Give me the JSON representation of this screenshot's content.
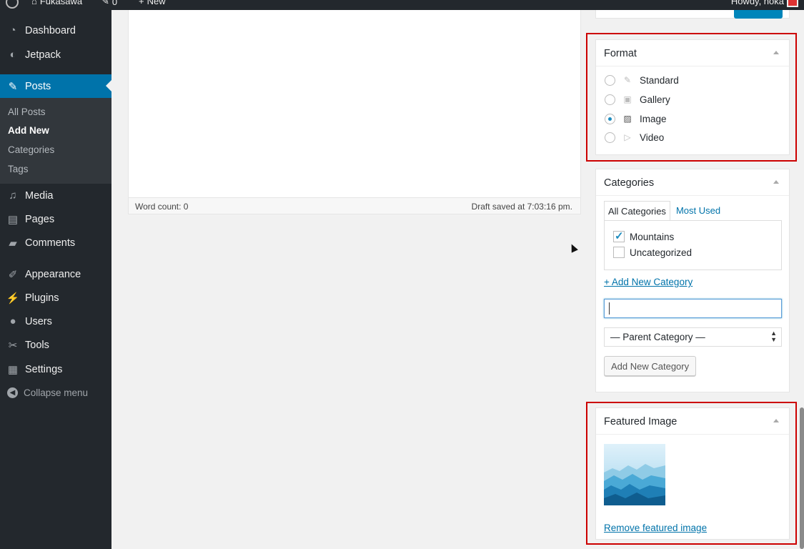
{
  "adminbar": {
    "site_name": "Fukasawa",
    "comments_count": "0",
    "new_label": "New",
    "howdy": "Howdy, noka"
  },
  "sidebar": {
    "items": [
      {
        "label": "Dashboard",
        "icon": "dashboard-icon"
      },
      {
        "label": "Jetpack",
        "icon": "jetpack-icon"
      },
      {
        "label": "Posts",
        "icon": "pushpin-icon"
      },
      {
        "label": "Media",
        "icon": "media-icon"
      },
      {
        "label": "Pages",
        "icon": "pages-icon"
      },
      {
        "label": "Comments",
        "icon": "comment-icon"
      },
      {
        "label": "Appearance",
        "icon": "brush-icon"
      },
      {
        "label": "Plugins",
        "icon": "plug-icon"
      },
      {
        "label": "Users",
        "icon": "user-icon"
      },
      {
        "label": "Tools",
        "icon": "wrench-icon"
      },
      {
        "label": "Settings",
        "icon": "settings-icon"
      }
    ],
    "posts_submenu": [
      "All Posts",
      "Add New",
      "Categories",
      "Tags"
    ],
    "collapse_label": "Collapse menu"
  },
  "editor": {
    "word_count": "Word count: 0",
    "draft_saved": "Draft saved at 7:03:16 pm."
  },
  "format_box": {
    "title": "Format",
    "options": [
      "Standard",
      "Gallery",
      "Image",
      "Video"
    ],
    "selected": "Image"
  },
  "categories_box": {
    "title": "Categories",
    "tab_all": "All Categories",
    "tab_used": "Most Used",
    "items": [
      {
        "label": "Mountains",
        "checked": true
      },
      {
        "label": "Uncategorized",
        "checked": false
      }
    ],
    "add_new_link": "+ Add New Category",
    "new_category_value": "",
    "parent_select": "— Parent Category —",
    "add_button": "Add New Category"
  },
  "featured_box": {
    "title": "Featured Image",
    "remove_link": "Remove featured image"
  },
  "colors": {
    "accent": "#0073aa",
    "sidebar_bg": "#23282d",
    "highlight": "#cc0000"
  }
}
